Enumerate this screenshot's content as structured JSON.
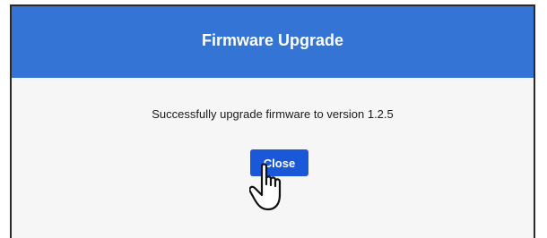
{
  "dialog": {
    "title": "Firmware Upgrade",
    "message": "Successfully upgrade firmware to version 1.2.5",
    "close_label": "Close"
  },
  "colors": {
    "header": "#3474d4",
    "button": "#1a58d8",
    "body": "#f6f6f6"
  },
  "cursor": {
    "icon": "hand-pointer-icon"
  }
}
